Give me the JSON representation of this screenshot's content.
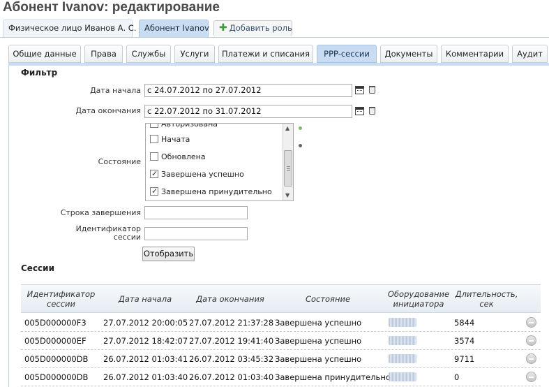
{
  "page_title": "Абонент Ivanov: редактирование",
  "top_tabs": [
    {
      "label": "Физическое лицо Иванов А. С."
    },
    {
      "label": "Абонент Ivanov"
    }
  ],
  "add_role_label": "Добавить роль",
  "sub_tabs": [
    {
      "label": "Общие данные"
    },
    {
      "label": "Права"
    },
    {
      "label": "Службы"
    },
    {
      "label": "Услуги"
    },
    {
      "label": "Платежи и списания"
    },
    {
      "label": "PPP-сессии"
    },
    {
      "label": "Документы"
    },
    {
      "label": "Комментарии"
    },
    {
      "label": "Аудит"
    }
  ],
  "active_sub_tab": "PPP-сессии",
  "filter": {
    "title": "Фильтр",
    "start_date_label": "Дата начала",
    "start_date_value": "с 24.07.2012 по 27.07.2012",
    "end_date_label": "Дата окончания",
    "end_date_value": "с 22.07.2012 по 31.07.2012",
    "state_label": "Состояние",
    "state_options": [
      {
        "label": "Авторизована",
        "checked": false
      },
      {
        "label": "Начата",
        "checked": false
      },
      {
        "label": "Обновлена",
        "checked": false
      },
      {
        "label": "Завершена успешно",
        "checked": true
      },
      {
        "label": "Завершена принудительно",
        "checked": true
      }
    ],
    "termination_label": "Строка завершения",
    "termination_value": "",
    "session_id_label_line1": "Идентификатор",
    "session_id_label_line2": "сессии",
    "session_id_value": "",
    "show_button": "Отобразить"
  },
  "sessions": {
    "title": "Сессии",
    "columns": [
      {
        "line1": "Идентификатор",
        "line2": "сессии"
      },
      {
        "line1": "Дата начала",
        "line2": ""
      },
      {
        "line1": "Дата окончания",
        "line2": ""
      },
      {
        "line1": "Состояние",
        "line2": ""
      },
      {
        "line1": "Оборудование",
        "line2": "инициатора"
      },
      {
        "line1": "Длительность,",
        "line2": "сек"
      }
    ],
    "rows": [
      {
        "id": "005D000000F3",
        "start": "27.07.2012 20:00:05",
        "end": "27.07.2012 21:37:28",
        "state": "Завершена успешно",
        "duration": "5844"
      },
      {
        "id": "005D000000EF",
        "start": "27.07.2012 18:42:07",
        "end": "27.07.2012 19:41:40",
        "state": "Завершена успешно",
        "duration": "3574"
      },
      {
        "id": "005D000000DB",
        "start": "26.07.2012 01:03:41",
        "end": "26.07.2012 03:45:32",
        "state": "Завершена успешно",
        "duration": "9711"
      },
      {
        "id": "005D000000DB",
        "start": "26.07.2012 01:03:40",
        "end": "26.07.2012 01:03:40",
        "state": "Завершена принудительно",
        "duration": "0"
      }
    ]
  },
  "colors": {
    "active_tab": "#c8ddf1",
    "tab_border": "#a8c4df",
    "header_bg": "#e6ecf2",
    "plus_green": "#3a9c3a"
  }
}
